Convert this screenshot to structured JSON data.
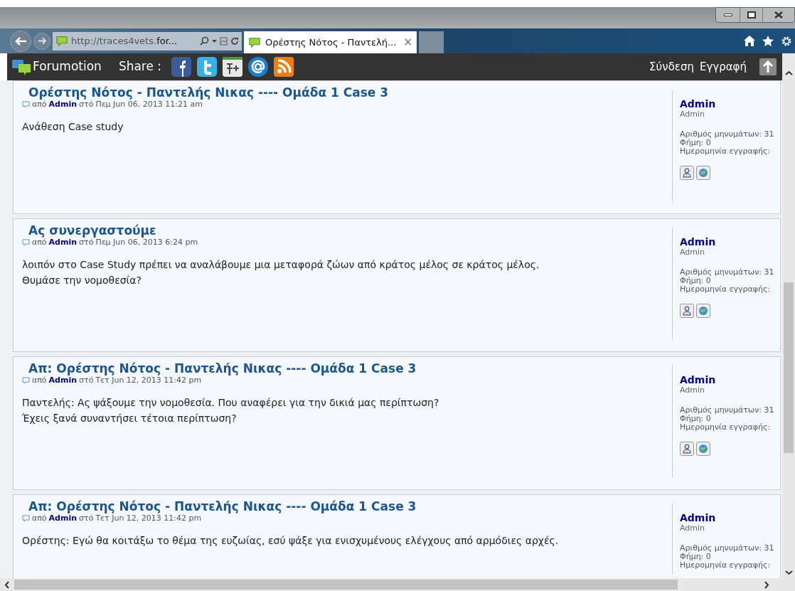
{
  "browser": {
    "address_dim": "http://traces4vets.",
    "address_bright": "for...",
    "tab": {
      "title": "Ορέστης Νότος - Παντελή...",
      "close": "×",
      "selected": true
    }
  },
  "forum_bar": {
    "brand": "Forumotion",
    "share_label": "Share :",
    "links": [
      "Σύνδεση",
      "Εγγραφή"
    ]
  },
  "posts": [
    {
      "title": "Ορέστης Νότος - Παντελής Νικας ---- Ομάδα 1 Case 3",
      "by": "από",
      "author": "Admin",
      "at": "στό",
      "date": "Πεμ Jun 06, 2013 11:21 am",
      "body": [
        "Ανάθεση Case study"
      ],
      "profile": {
        "name": "Admin",
        "rank": "Admin",
        "stats": [
          "Αριθμός μηνυμάτων: 31",
          "Φήμη: 0",
          "Ημερομηνία εγγραφής:"
        ]
      }
    },
    {
      "title": "Ας συνεργαστούμε",
      "by": "από",
      "author": "Admin",
      "at": "στό",
      "date": "Πεμ Jun 06, 2013 6:24 pm",
      "body": [
        "λοιπόν στο Case Study πρέπει να αναλάβουμε μια μεταφορά ζώων από κράτος μέλος σε κράτος μέλος.",
        "Θυμάσε την νομοθεσία?"
      ],
      "profile": {
        "name": "Admin",
        "rank": "Admin",
        "stats": [
          "Αριθμός μηνυμάτων: 31",
          "Φήμη: 0",
          "Ημερομηνία εγγραφής:"
        ]
      }
    },
    {
      "title": "Απ: Ορέστης Νότος - Παντελής Νικας ---- Ομάδα 1 Case 3",
      "by": "από",
      "author": "Admin",
      "at": "στό",
      "date": "Τετ Jun 12, 2013 11:42 pm",
      "body": [
        "Παντελής: Ας ψάξουμε την νομοθεσία. Που αναφέρει για την δικιά μας περίπτωση?",
        "Έχεις ξανά συναντήσει τέτοια περίπτωση?"
      ],
      "profile": {
        "name": "Admin",
        "rank": "Admin",
        "stats": [
          "Αριθμός μηνυμάτων: 31",
          "Φήμη: 0",
          "Ημερομηνία εγγραφής:"
        ]
      }
    },
    {
      "title": "Απ: Ορέστης Νότος - Παντελής Νικας ---- Ομάδα 1 Case 3",
      "by": "από",
      "author": "Admin",
      "at": "στό",
      "date": "Τετ Jun 12, 2013 11:42 pm",
      "body": [
        "Ορέστης: Εγώ θα κοιτάξω το θέμα της ευζωίας, εσύ ψάξε για ενισχυμένους ελέγχους από αρμόδιες αρχές."
      ],
      "profile": {
        "name": "Admin",
        "rank": "Admin",
        "stats": [
          "Αριθμός μηνυμάτων: 31",
          "Φήμη: 0",
          "Ημερομηνία εγγραφής:"
        ]
      }
    }
  ]
}
